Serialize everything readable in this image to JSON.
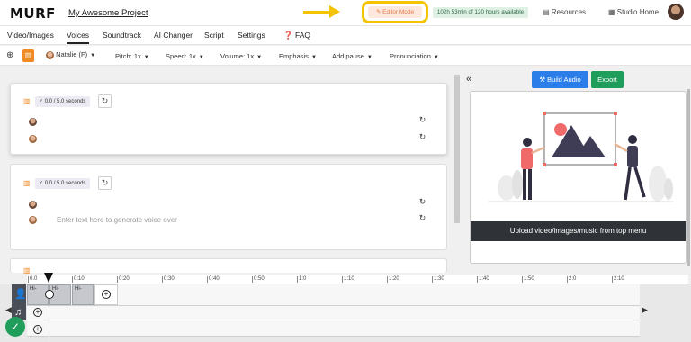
{
  "header": {
    "logo": "MURF",
    "project_title": "My Awesome Project",
    "editor_mode_label": "Editor Mode",
    "hours_available": "102h 53min of 120 hours available",
    "resources_label": "Resources",
    "studio_home_label": "Studio Home",
    "accent_color": "#f5c400"
  },
  "tabs": [
    {
      "label": "Video/Images"
    },
    {
      "label": "Voices",
      "active": true
    },
    {
      "label": "Soundtrack"
    },
    {
      "label": "AI Changer"
    },
    {
      "label": "Script"
    },
    {
      "label": "Settings"
    },
    {
      "label": "FAQ",
      "icon": "question-icon"
    }
  ],
  "toolbar": {
    "voice": "Natalie (F)",
    "pitch": "Pitch: 1x",
    "speed": "Speed: 1x",
    "volume": "Volume: 1x",
    "emphasis": "Emphasis",
    "pause": "Add pause",
    "pronunciation": "Pronunciation"
  },
  "blocks": [
    {
      "duration": "0.0 / 5.0 seconds",
      "placeholder": ""
    },
    {
      "duration": "0.0 / 5.0 seconds",
      "placeholder": "Enter text here to generate voice over"
    }
  ],
  "preview": {
    "build_audio_label": "Build Audio",
    "export_label": "Export",
    "caption": "Upload video/images/music from top menu"
  },
  "timeline": {
    "ticks": [
      "0.0",
      "0:10",
      "0:20",
      "0:30",
      "0:40",
      "0:50",
      "1:0",
      "1:10",
      "1:20",
      "1:30",
      "1:40",
      "1:50",
      "2:0",
      "2:10"
    ],
    "clip_label": "Hi-"
  }
}
